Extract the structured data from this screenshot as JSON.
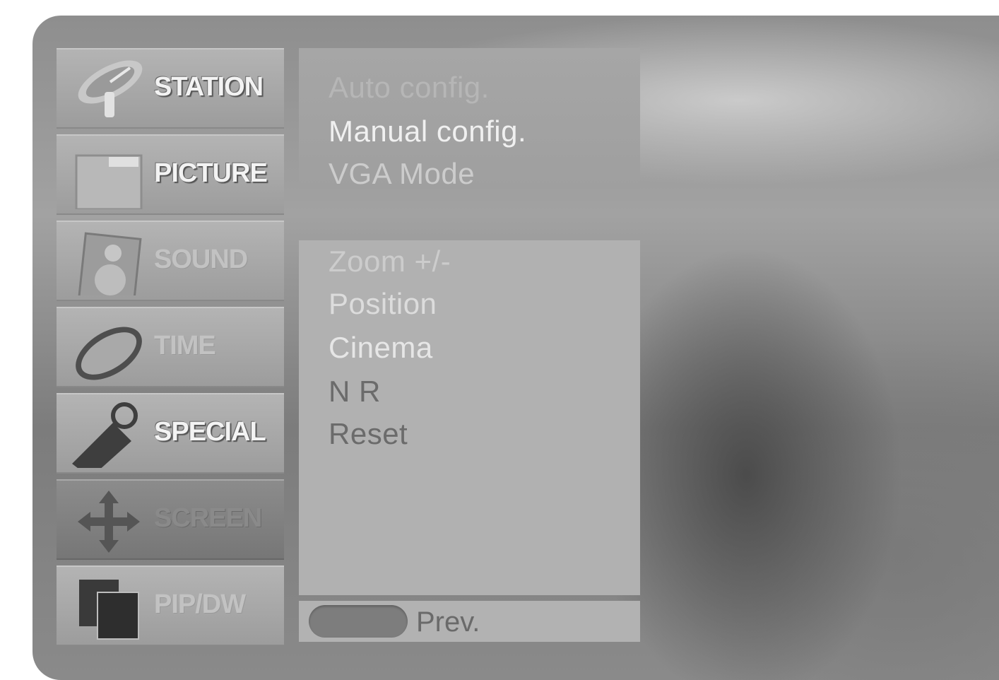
{
  "sidebar": {
    "items": [
      {
        "label": "STATION",
        "icon": "satellite-dish-icon"
      },
      {
        "label": "PICTURE",
        "icon": "picture-frame-icon"
      },
      {
        "label": "SOUND",
        "icon": "speaker-icon"
      },
      {
        "label": "TIME",
        "icon": "clock-icon"
      },
      {
        "label": "SPECIAL",
        "icon": "tag-icon"
      },
      {
        "label": "SCREEN",
        "icon": "move-arrows-icon",
        "selected": true
      },
      {
        "label": "PIP/DW",
        "icon": "pip-windows-icon"
      }
    ]
  },
  "submenu_top": {
    "items": [
      "Auto config.",
      "Manual config.",
      "VGA Mode"
    ]
  },
  "submenu_main": {
    "items": [
      "Zoom +/-",
      "Position",
      "Cinema",
      "N R",
      "Reset"
    ]
  },
  "footer": {
    "prev_label": "Prev."
  },
  "colors": {
    "panel": "#b1b1b1",
    "tile": "#a9a9a9",
    "tile_active": "#808080",
    "button": "#7d7d7d"
  }
}
